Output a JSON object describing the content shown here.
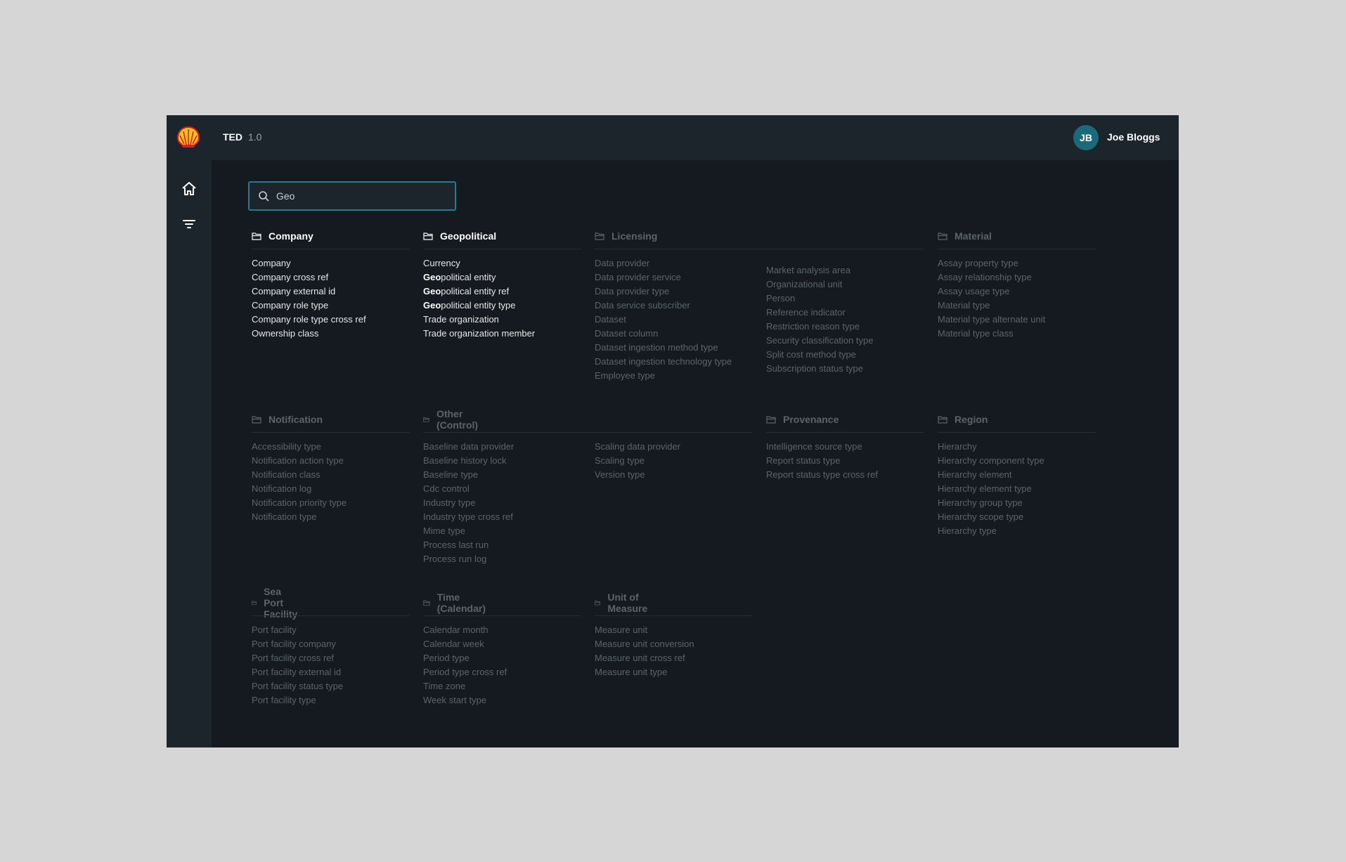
{
  "header": {
    "app_name": "TED",
    "version": "1.0",
    "user_initials": "JB",
    "user_name": "Joe Bloggs"
  },
  "search": {
    "value": "Geo",
    "query": "Geo"
  },
  "categories": [
    {
      "name": "Company",
      "active": true,
      "items": [
        "Company",
        "Company cross ref",
        "Company external id",
        "Company role type",
        "Company role type cross ref",
        "Ownership class"
      ]
    },
    {
      "name": "Geopolitical",
      "active": true,
      "items": [
        "Currency",
        "Geopolitical entity",
        "Geopolitical entity ref",
        "Geopolitical entity type",
        "Trade organization",
        "Trade organization member"
      ]
    },
    {
      "name": "Licensing",
      "active": false,
      "items": [
        "Data provider",
        "Data provider service",
        "Data provider type",
        "Data service subscriber",
        "Dataset",
        "Dataset column",
        "Dataset ingestion method type",
        "Dataset ingestion technology type",
        "Employee type"
      ],
      "items2": [
        "Market analysis area",
        "Organizational unit",
        "Person",
        "Reference indicator",
        "Restriction reason type",
        "Security classification type",
        "Split cost method type",
        "Subscription status type"
      ]
    },
    {
      "name": "Material",
      "active": false,
      "items": [
        "Assay property type",
        "Assay relationship type",
        "Assay usage type",
        "Material type",
        "Material type alternate unit",
        "Material type class"
      ]
    },
    {
      "name": "Notification",
      "active": false,
      "items": [
        "Accessibility type",
        "Notification action type",
        "Notification class",
        "Notification log",
        "Notification priority type",
        "Notification type"
      ]
    },
    {
      "name": "Other (Control)",
      "active": false,
      "items": [
        "Baseline data provider",
        "Baseline history lock",
        "Baseline type",
        "Cdc control",
        "Industry type",
        "Industry type cross ref",
        "Mime type",
        "Process last run",
        "Process run log"
      ],
      "items2": [
        "Scaling data provider",
        "Scaling type",
        "Version type"
      ]
    },
    {
      "name": "Provenance",
      "active": false,
      "items": [
        "Intelligence source type",
        "Report status type",
        "Report status type cross ref"
      ]
    },
    {
      "name": "Region",
      "active": false,
      "items": [
        "Hierarchy",
        "Hierarchy component type",
        "Hierarchy element",
        "Hierarchy element type",
        "Hierarchy group type",
        "Hierarchy scope type",
        "Hierarchy type"
      ]
    },
    {
      "name": "Sea Port Facility",
      "active": false,
      "items": [
        "Port facility",
        "Port facility company",
        "Port facility cross ref",
        "Port facility external id",
        "Port facility status type",
        "Port facility type"
      ]
    },
    {
      "name": "Time (Calendar)",
      "active": false,
      "items": [
        "Calendar month",
        "Calendar week",
        "Period type",
        "Period type cross ref",
        "Time zone",
        "Week start type"
      ]
    },
    {
      "name": "Unit of Measure",
      "active": false,
      "items": [
        "Measure unit",
        "Measure unit conversion",
        "Measure unit cross ref",
        "Measure unit type"
      ]
    }
  ],
  "colors": {
    "background": "#141a1f",
    "bar": "#1c242c",
    "accent": "#1f7f8f",
    "dim_text": "#5b646c",
    "bright_text": "#ffffff"
  },
  "icons": {
    "logo": "shell-logo",
    "home": "home-icon",
    "filter": "filter-icon",
    "search": "search-icon",
    "folder": "folder-icon"
  }
}
